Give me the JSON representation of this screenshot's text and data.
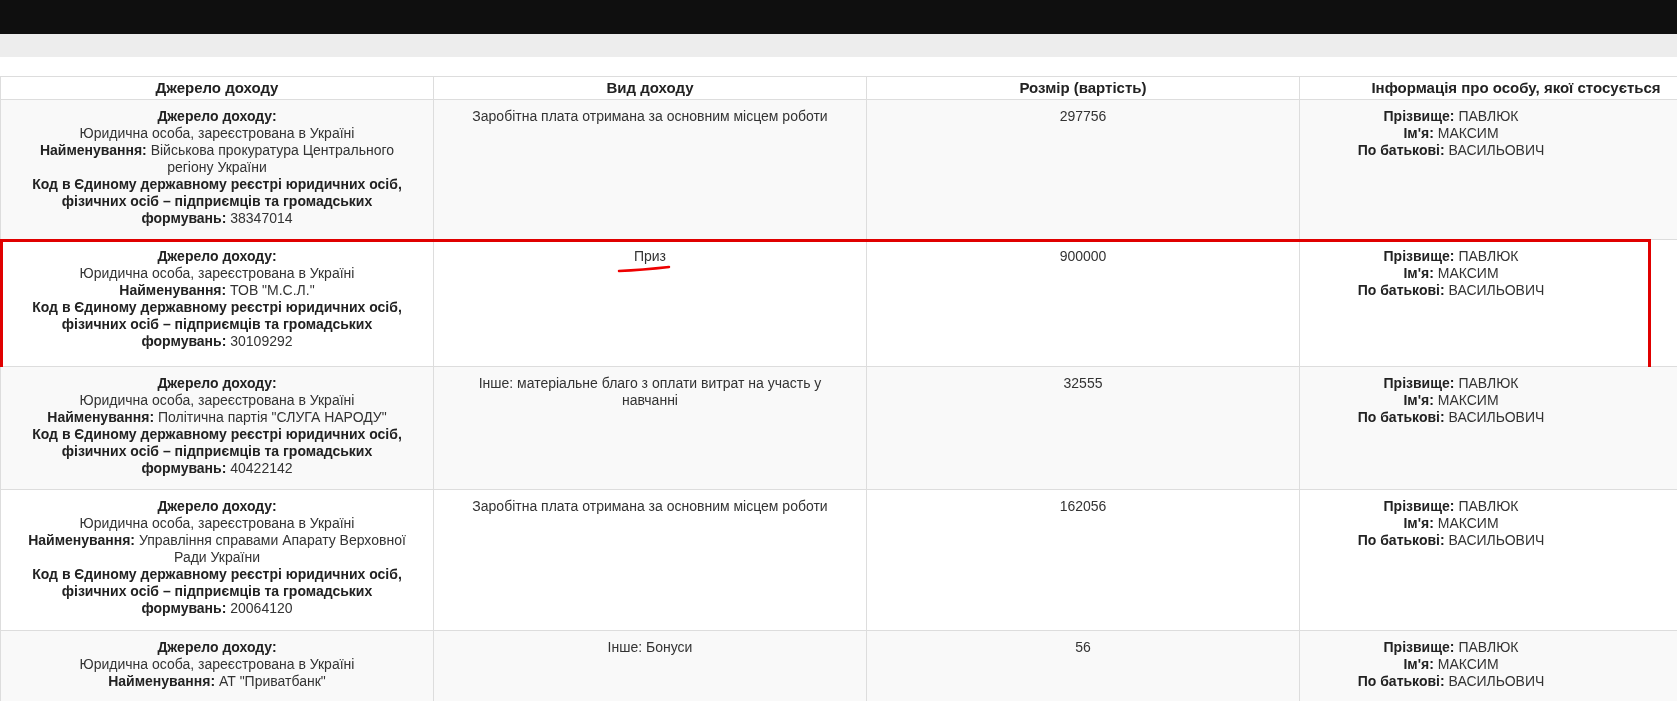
{
  "columns": [
    "Джерело доходу",
    "Вид доходу",
    "Розмір (вартість)",
    "Інформація про особу, якої стосується"
  ],
  "rows": [
    {
      "highlighted": false,
      "source": [
        {
          "kind": "stacked",
          "label": "Джерело доходу:",
          "value": "Юридична особа, зареєстрована в Україні"
        },
        {
          "kind": "inline",
          "label": "Найменування:",
          "value": "Військова прокуратура Центрального регіону України"
        },
        {
          "kind": "inline",
          "label": "Код в Єдиному державному реєстрі юридичних осіб, фізичних осіб – підприємців та громадських формувань:",
          "value": "38347014"
        }
      ],
      "income_type": {
        "text": "Заробітна плата отримана за основним місцем роботи",
        "underlined": false
      },
      "amount": "297756",
      "person": [
        {
          "label": "Прізвище:",
          "value": "ПАВЛЮК"
        },
        {
          "label": "Ім'я:",
          "value": "МАКСИМ"
        },
        {
          "label": "По батькові:",
          "value": "ВАСИЛЬОВИЧ"
        }
      ]
    },
    {
      "highlighted": true,
      "source": [
        {
          "kind": "stacked",
          "label": "Джерело доходу:",
          "value": "Юридична особа, зареєстрована в Україні"
        },
        {
          "kind": "inline",
          "label": "Найменування:",
          "value": "ТОВ \"М.С.Л.\""
        },
        {
          "kind": "inline",
          "label": "Код в Єдиному державному реєстрі юридичних осіб, фізичних осіб – підприємців та громадських формувань:",
          "value": "30109292"
        }
      ],
      "income_type": {
        "text": "Приз",
        "underlined": true
      },
      "amount": "900000",
      "person": [
        {
          "label": "Прізвище:",
          "value": "ПАВЛЮК"
        },
        {
          "label": "Ім'я:",
          "value": "МАКСИМ"
        },
        {
          "label": "По батькові:",
          "value": "ВАСИЛЬОВИЧ"
        }
      ]
    },
    {
      "highlighted": false,
      "source": [
        {
          "kind": "stacked",
          "label": "Джерело доходу:",
          "value": "Юридична особа, зареєстрована в Україні"
        },
        {
          "kind": "inline",
          "label": "Найменування:",
          "value": "Політична партія \"СЛУГА НАРОДУ\""
        },
        {
          "kind": "inline",
          "label": "Код в Єдиному державному реєстрі юридичних осіб, фізичних осіб – підприємців та громадських формувань:",
          "value": "40422142"
        }
      ],
      "income_type": {
        "text": "Інше: матеріальне благо з оплати витрат на участь у навчанні",
        "underlined": false
      },
      "amount": "32555",
      "person": [
        {
          "label": "Прізвище:",
          "value": "ПАВЛЮК"
        },
        {
          "label": "Ім'я:",
          "value": "МАКСИМ"
        },
        {
          "label": "По батькові:",
          "value": "ВАСИЛЬОВИЧ"
        }
      ]
    },
    {
      "highlighted": false,
      "source": [
        {
          "kind": "stacked",
          "label": "Джерело доходу:",
          "value": "Юридична особа, зареєстрована в Україні"
        },
        {
          "kind": "inline",
          "label": "Найменування:",
          "value": "Управління справами Апарату Верховної Ради України"
        },
        {
          "kind": "inline",
          "label": "Код в Єдиному державному реєстрі юридичних осіб, фізичних осіб – підприємців та громадських формувань:",
          "value": "20064120"
        }
      ],
      "income_type": {
        "text": "Заробітна плата отримана за основним місцем роботи",
        "underlined": false
      },
      "amount": "162056",
      "person": [
        {
          "label": "Прізвище:",
          "value": "ПАВЛЮК"
        },
        {
          "label": "Ім'я:",
          "value": "МАКСИМ"
        },
        {
          "label": "По батькові:",
          "value": "ВАСИЛЬОВИЧ"
        }
      ]
    },
    {
      "highlighted": false,
      "source": [
        {
          "kind": "stacked",
          "label": "Джерело доходу:",
          "value": "Юридична особа, зареєстрована в Україні"
        },
        {
          "kind": "inline",
          "label": "Найменування:",
          "value": "АТ \"Приватбанк\""
        }
      ],
      "income_type": {
        "text": "Інше: Бонуси",
        "underlined": false
      },
      "amount": "56",
      "person": [
        {
          "label": "Прізвище:",
          "value": "ПАВЛЮК"
        },
        {
          "label": "Ім'я:",
          "value": "МАКСИМ"
        },
        {
          "label": "По батькові:",
          "value": "ВАСИЛЬОВИЧ"
        }
      ]
    }
  ]
}
